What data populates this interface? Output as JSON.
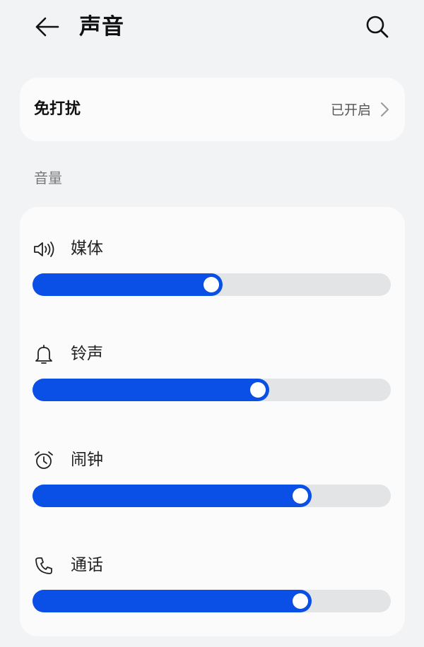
{
  "header": {
    "title": "声音",
    "back_icon": "arrow-left-icon",
    "search_icon": "search-icon"
  },
  "do_not_disturb": {
    "label": "免打扰",
    "status": "已开启"
  },
  "volume_section": {
    "label": "音量",
    "sliders": [
      {
        "label": "媒体",
        "icon": "speaker-icon",
        "value_percent": 53
      },
      {
        "label": "铃声",
        "icon": "bell-icon",
        "value_percent": 66
      },
      {
        "label": "闹钟",
        "icon": "alarm-clock-icon",
        "value_percent": 78
      },
      {
        "label": "通话",
        "icon": "phone-icon",
        "value_percent": 78
      }
    ]
  },
  "colors": {
    "accent": "#0a4fe6",
    "track": "#e3e4e6",
    "card": "#fbfbfc",
    "background": "#f1f3f5"
  }
}
